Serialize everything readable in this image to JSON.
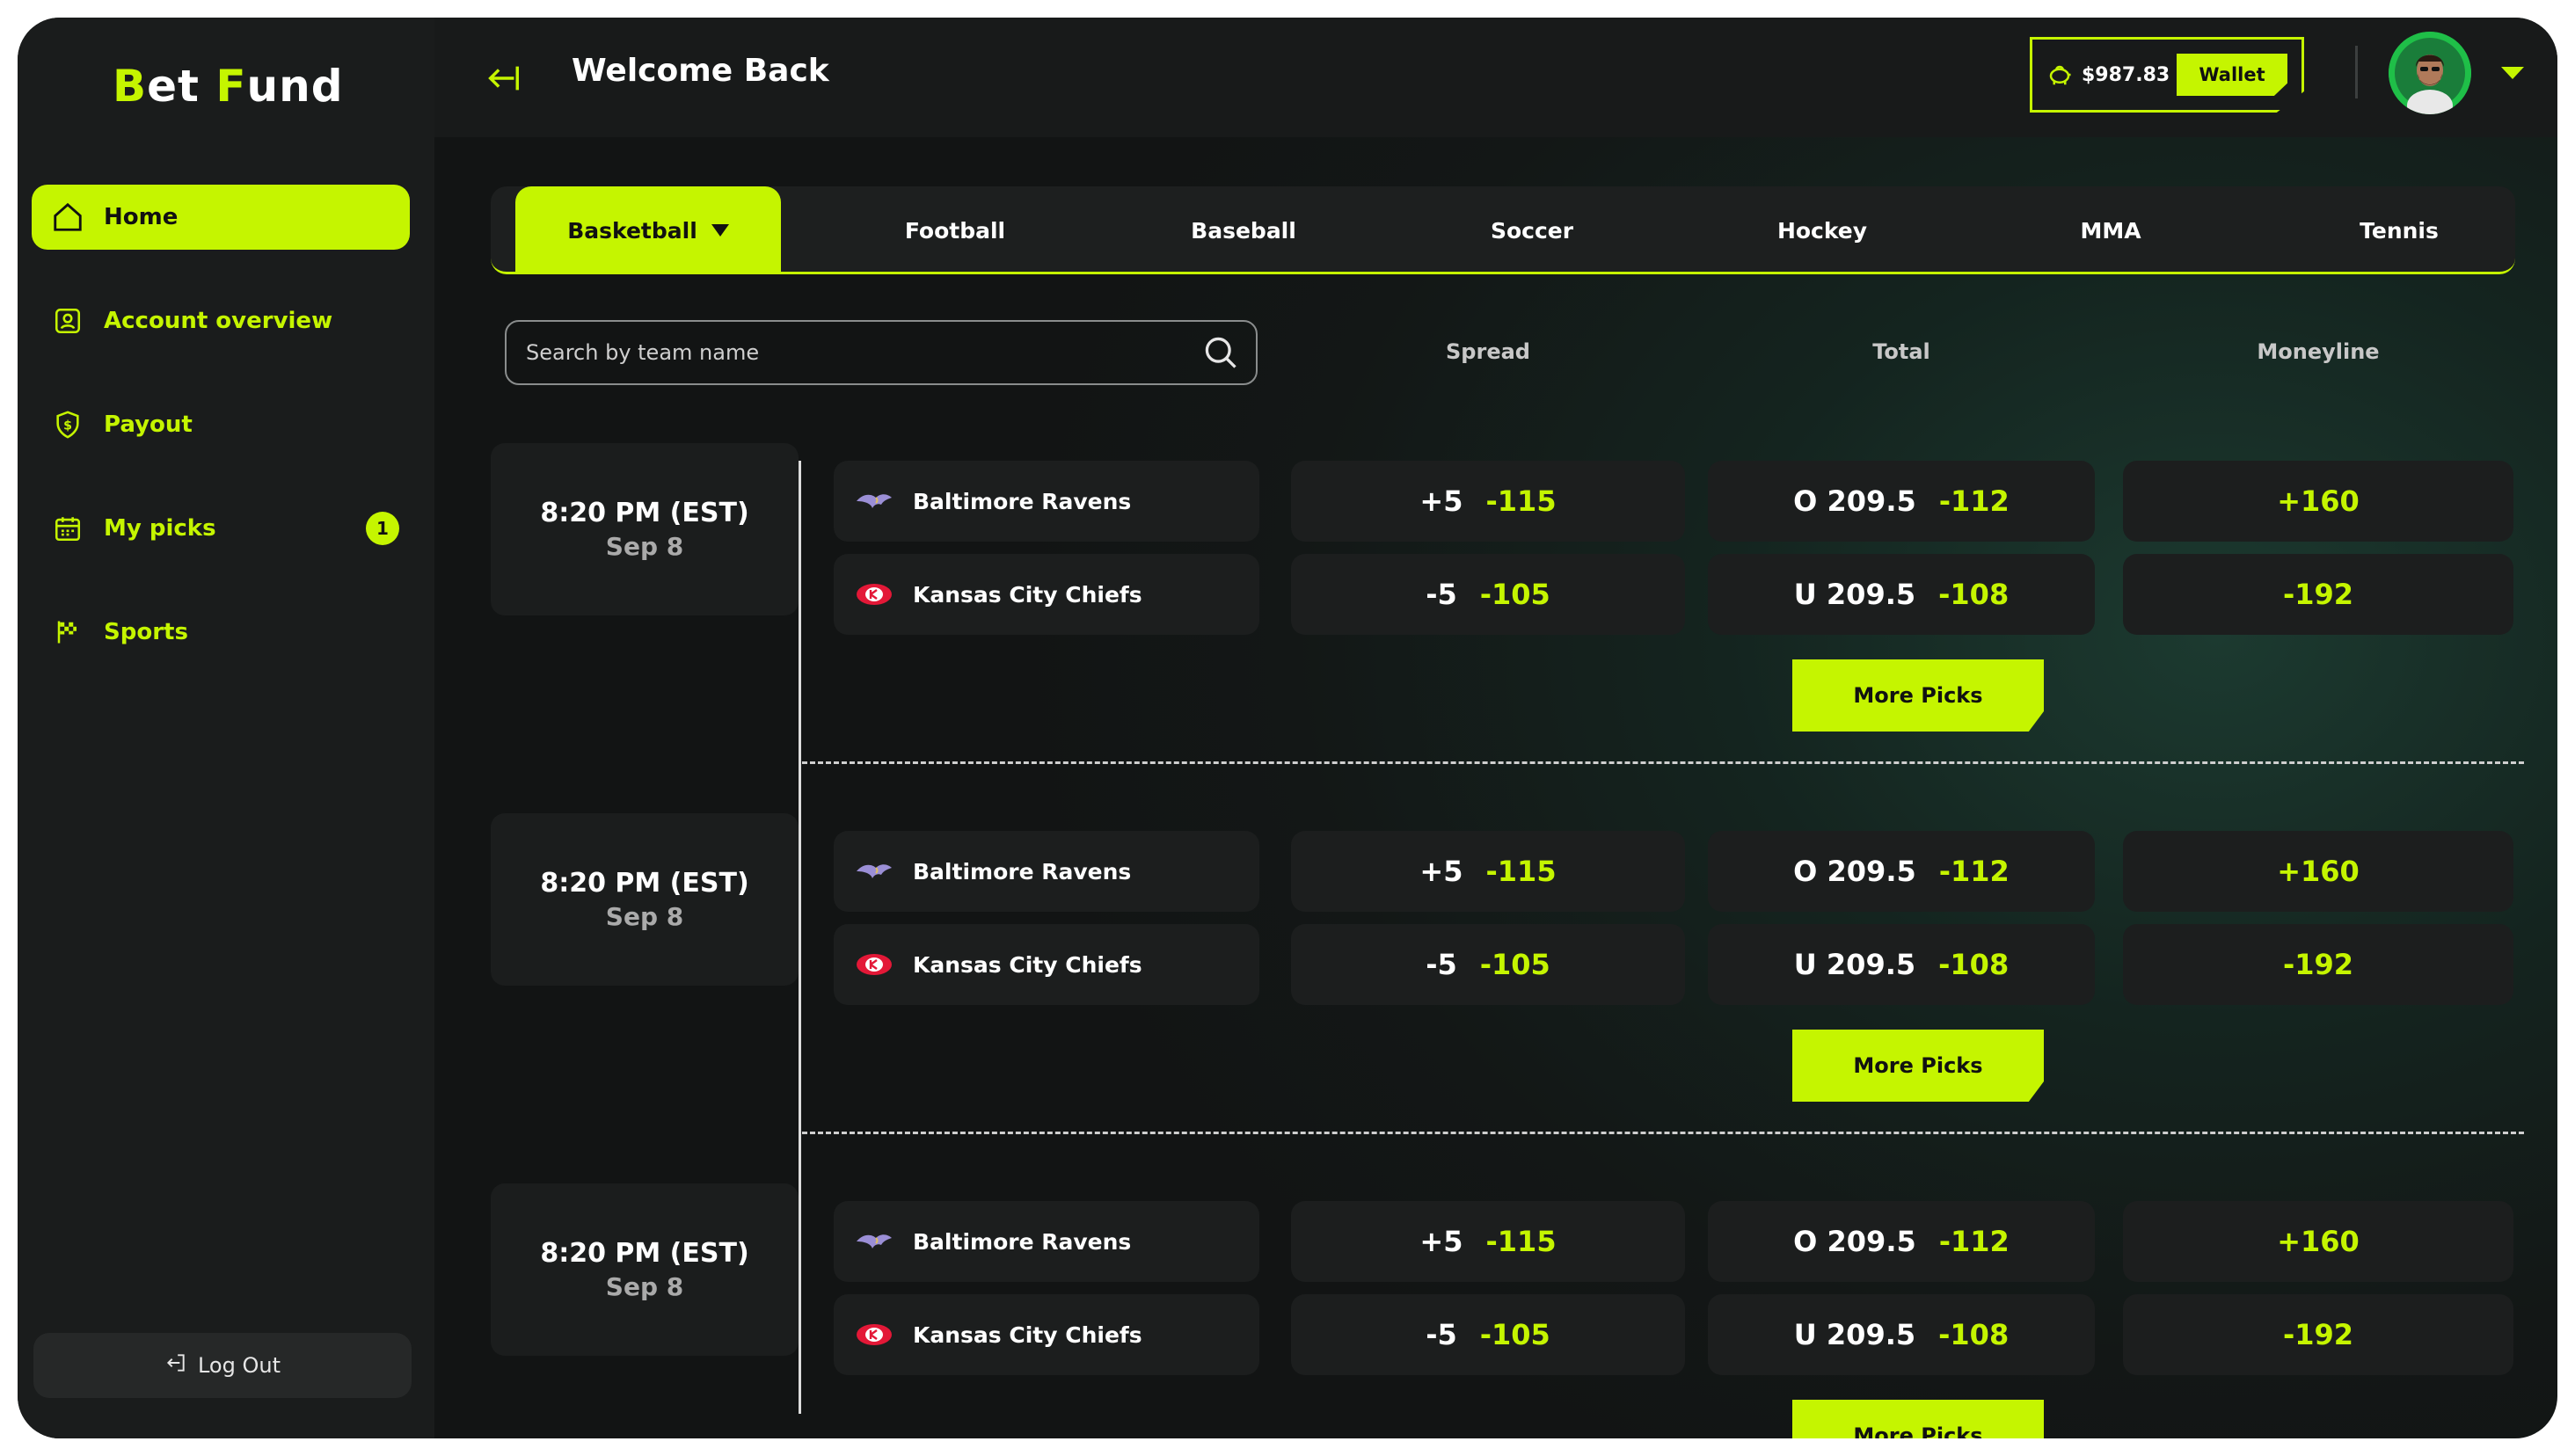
{
  "brand": {
    "logo_b": "B",
    "logo_et": "et",
    "logo_f": "F",
    "logo_und": "und"
  },
  "header": {
    "title": "Welcome Back",
    "wallet_amount": "$987.83",
    "wallet_label": "Wallet"
  },
  "sidebar": {
    "items": [
      {
        "label": "Home",
        "icon": "home-icon"
      },
      {
        "label": "Account overview",
        "icon": "account-icon"
      },
      {
        "label": "Payout",
        "icon": "shield-dollar-icon"
      },
      {
        "label": "My picks",
        "icon": "calendar-icon",
        "badge": "1"
      },
      {
        "label": "Sports",
        "icon": "checkered-flag-icon"
      }
    ],
    "logout_label": "Log Out"
  },
  "tabs": [
    "Basketball",
    "Football",
    "Baseball",
    "Soccer",
    "Hockey",
    "MMA",
    "Tennis"
  ],
  "search": {
    "placeholder": "Search by team name"
  },
  "columns": {
    "spread": "Spread",
    "total": "Total",
    "moneyline": "Moneyline"
  },
  "games": [
    {
      "time": "8:20 PM (EST)",
      "date": "Sep 8",
      "teams": [
        {
          "name": "Baltimore Ravens",
          "spread_line": "+5",
          "spread_odds": "-115",
          "total_line": "O 209.5",
          "total_odds": "-112",
          "moneyline": "+160"
        },
        {
          "name": "Kansas City Chiefs",
          "spread_line": "-5",
          "spread_odds": "-105",
          "total_line": "U 209.5",
          "total_odds": "-108",
          "moneyline": "-192"
        }
      ],
      "more_label": "More Picks"
    },
    {
      "time": "8:20 PM (EST)",
      "date": "Sep 8",
      "teams": [
        {
          "name": "Baltimore Ravens",
          "spread_line": "+5",
          "spread_odds": "-115",
          "total_line": "O 209.5",
          "total_odds": "-112",
          "moneyline": "+160"
        },
        {
          "name": "Kansas City Chiefs",
          "spread_line": "-5",
          "spread_odds": "-105",
          "total_line": "U 209.5",
          "total_odds": "-108",
          "moneyline": "-192"
        }
      ],
      "more_label": "More Picks"
    },
    {
      "time": "8:20 PM (EST)",
      "date": "Sep 8",
      "teams": [
        {
          "name": "Baltimore Ravens",
          "spread_line": "+5",
          "spread_odds": "-115",
          "total_line": "O 209.5",
          "total_odds": "-112",
          "moneyline": "+160"
        },
        {
          "name": "Kansas City Chiefs",
          "spread_line": "-5",
          "spread_odds": "-105",
          "total_line": "U 209.5",
          "total_odds": "-108",
          "moneyline": "-192"
        }
      ],
      "more_label": "More Picks"
    }
  ],
  "colors": {
    "accent": "#c5f500",
    "background": "#131716",
    "panel": "#1c1e1e"
  }
}
